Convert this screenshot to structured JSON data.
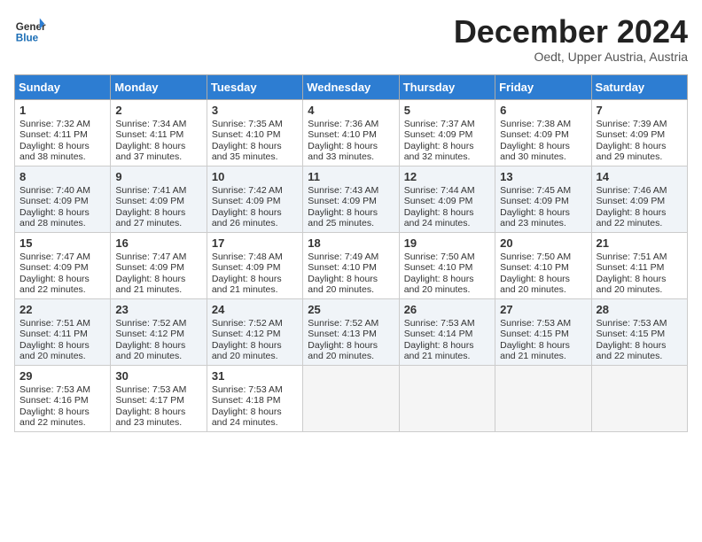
{
  "header": {
    "logo_general": "General",
    "logo_blue": "Blue",
    "month": "December 2024",
    "location": "Oedt, Upper Austria, Austria"
  },
  "days_of_week": [
    "Sunday",
    "Monday",
    "Tuesday",
    "Wednesday",
    "Thursday",
    "Friday",
    "Saturday"
  ],
  "weeks": [
    [
      {
        "day": 1,
        "info": "Sunrise: 7:32 AM\nSunset: 4:11 PM\nDaylight: 8 hours and 38 minutes."
      },
      {
        "day": 2,
        "info": "Sunrise: 7:34 AM\nSunset: 4:11 PM\nDaylight: 8 hours and 37 minutes."
      },
      {
        "day": 3,
        "info": "Sunrise: 7:35 AM\nSunset: 4:10 PM\nDaylight: 8 hours and 35 minutes."
      },
      {
        "day": 4,
        "info": "Sunrise: 7:36 AM\nSunset: 4:10 PM\nDaylight: 8 hours and 33 minutes."
      },
      {
        "day": 5,
        "info": "Sunrise: 7:37 AM\nSunset: 4:09 PM\nDaylight: 8 hours and 32 minutes."
      },
      {
        "day": 6,
        "info": "Sunrise: 7:38 AM\nSunset: 4:09 PM\nDaylight: 8 hours and 30 minutes."
      },
      {
        "day": 7,
        "info": "Sunrise: 7:39 AM\nSunset: 4:09 PM\nDaylight: 8 hours and 29 minutes."
      }
    ],
    [
      {
        "day": 8,
        "info": "Sunrise: 7:40 AM\nSunset: 4:09 PM\nDaylight: 8 hours and 28 minutes."
      },
      {
        "day": 9,
        "info": "Sunrise: 7:41 AM\nSunset: 4:09 PM\nDaylight: 8 hours and 27 minutes."
      },
      {
        "day": 10,
        "info": "Sunrise: 7:42 AM\nSunset: 4:09 PM\nDaylight: 8 hours and 26 minutes."
      },
      {
        "day": 11,
        "info": "Sunrise: 7:43 AM\nSunset: 4:09 PM\nDaylight: 8 hours and 25 minutes."
      },
      {
        "day": 12,
        "info": "Sunrise: 7:44 AM\nSunset: 4:09 PM\nDaylight: 8 hours and 24 minutes."
      },
      {
        "day": 13,
        "info": "Sunrise: 7:45 AM\nSunset: 4:09 PM\nDaylight: 8 hours and 23 minutes."
      },
      {
        "day": 14,
        "info": "Sunrise: 7:46 AM\nSunset: 4:09 PM\nDaylight: 8 hours and 22 minutes."
      }
    ],
    [
      {
        "day": 15,
        "info": "Sunrise: 7:47 AM\nSunset: 4:09 PM\nDaylight: 8 hours and 22 minutes."
      },
      {
        "day": 16,
        "info": "Sunrise: 7:47 AM\nSunset: 4:09 PM\nDaylight: 8 hours and 21 minutes."
      },
      {
        "day": 17,
        "info": "Sunrise: 7:48 AM\nSunset: 4:09 PM\nDaylight: 8 hours and 21 minutes."
      },
      {
        "day": 18,
        "info": "Sunrise: 7:49 AM\nSunset: 4:10 PM\nDaylight: 8 hours and 20 minutes."
      },
      {
        "day": 19,
        "info": "Sunrise: 7:50 AM\nSunset: 4:10 PM\nDaylight: 8 hours and 20 minutes."
      },
      {
        "day": 20,
        "info": "Sunrise: 7:50 AM\nSunset: 4:10 PM\nDaylight: 8 hours and 20 minutes."
      },
      {
        "day": 21,
        "info": "Sunrise: 7:51 AM\nSunset: 4:11 PM\nDaylight: 8 hours and 20 minutes."
      }
    ],
    [
      {
        "day": 22,
        "info": "Sunrise: 7:51 AM\nSunset: 4:11 PM\nDaylight: 8 hours and 20 minutes."
      },
      {
        "day": 23,
        "info": "Sunrise: 7:52 AM\nSunset: 4:12 PM\nDaylight: 8 hours and 20 minutes."
      },
      {
        "day": 24,
        "info": "Sunrise: 7:52 AM\nSunset: 4:12 PM\nDaylight: 8 hours and 20 minutes."
      },
      {
        "day": 25,
        "info": "Sunrise: 7:52 AM\nSunset: 4:13 PM\nDaylight: 8 hours and 20 minutes."
      },
      {
        "day": 26,
        "info": "Sunrise: 7:53 AM\nSunset: 4:14 PM\nDaylight: 8 hours and 21 minutes."
      },
      {
        "day": 27,
        "info": "Sunrise: 7:53 AM\nSunset: 4:15 PM\nDaylight: 8 hours and 21 minutes."
      },
      {
        "day": 28,
        "info": "Sunrise: 7:53 AM\nSunset: 4:15 PM\nDaylight: 8 hours and 22 minutes."
      }
    ],
    [
      {
        "day": 29,
        "info": "Sunrise: 7:53 AM\nSunset: 4:16 PM\nDaylight: 8 hours and 22 minutes."
      },
      {
        "day": 30,
        "info": "Sunrise: 7:53 AM\nSunset: 4:17 PM\nDaylight: 8 hours and 23 minutes."
      },
      {
        "day": 31,
        "info": "Sunrise: 7:53 AM\nSunset: 4:18 PM\nDaylight: 8 hours and 24 minutes."
      },
      null,
      null,
      null,
      null
    ]
  ]
}
